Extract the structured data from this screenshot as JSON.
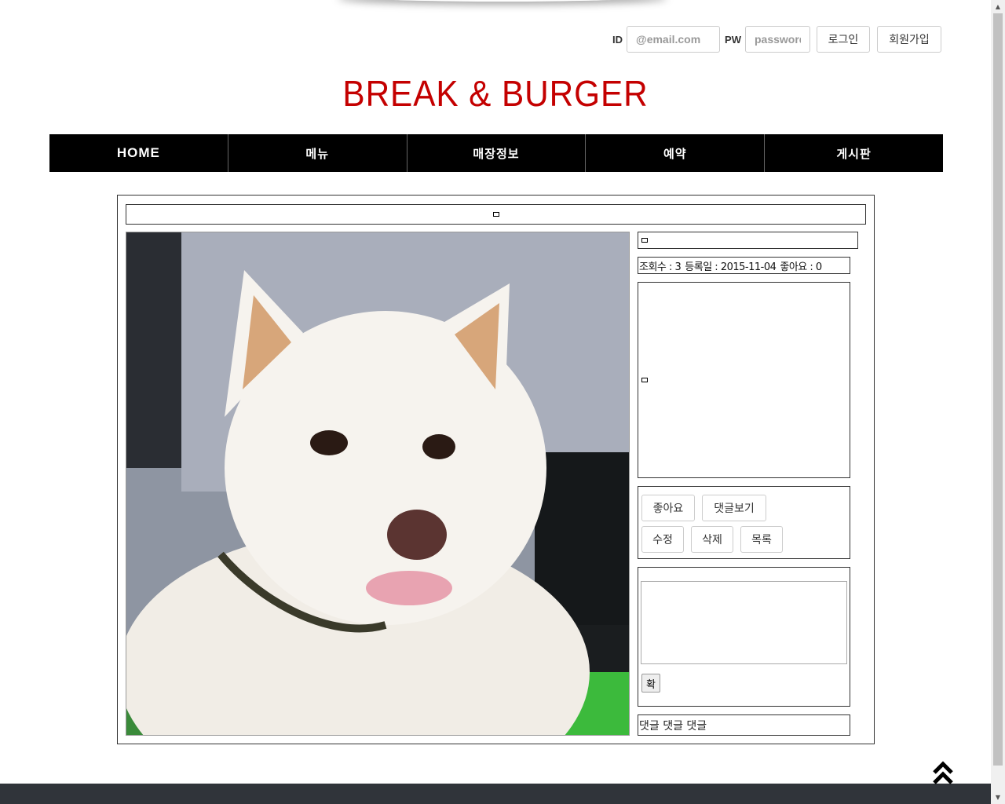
{
  "header": {
    "id_label": "ID",
    "id_placeholder": "@email.com",
    "pw_label": "PW",
    "pw_placeholder": "password",
    "login_label": "로그인",
    "join_label": "회원가입"
  },
  "brand": {
    "title": "BREAK & BURGER",
    "color": "#c40000"
  },
  "nav": {
    "items": [
      "HOME",
      "메뉴",
      "매장정보",
      "예약",
      "게시판"
    ]
  },
  "post": {
    "title": "",
    "views": "조회수 : 3",
    "date": "등록일 : 2015-11-04",
    "likes": "좋아요 : 0",
    "content": "",
    "photo_icon": "dog-photo"
  },
  "actions": {
    "like_label": "좋아요",
    "view_comments_label": "댓글보기",
    "edit_label": "수정",
    "delete_label": "삭제",
    "list_label": "목록"
  },
  "comment": {
    "confirm_label": "확",
    "comments_text": "댓글 댓글 댓글"
  },
  "icons": {
    "scroll_top": "chevron-double-up-icon"
  }
}
